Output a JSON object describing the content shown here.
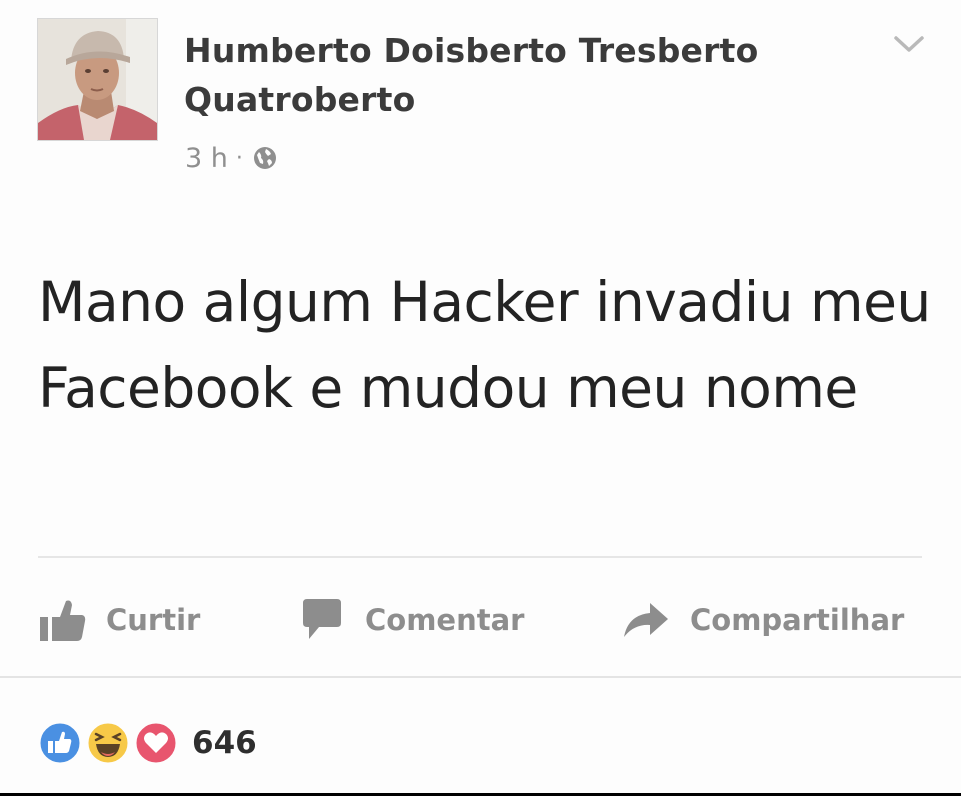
{
  "post": {
    "author": "Humberto Doisberto Tresberto Quatroberto",
    "timestamp": "3 h",
    "separator": "·",
    "message": "Mano algum Hacker invadiu meu Facebook e mudou meu nome"
  },
  "actions": {
    "like_label": "Curtir",
    "comment_label": "Comentar",
    "share_label": "Compartilhar"
  },
  "reactions": {
    "types": [
      "like",
      "haha",
      "love"
    ],
    "count": "646"
  },
  "icons": {
    "menu": "chevron-down-icon",
    "privacy": "globe-icon",
    "like": "thumbs-up-icon",
    "comment": "speech-bubble-icon",
    "share": "share-arrow-icon"
  },
  "colors": {
    "like_blue": "#4a90e2",
    "haha_yellow": "#f7c948",
    "love_red": "#e8556e",
    "action_gray": "#8d8d8d"
  }
}
